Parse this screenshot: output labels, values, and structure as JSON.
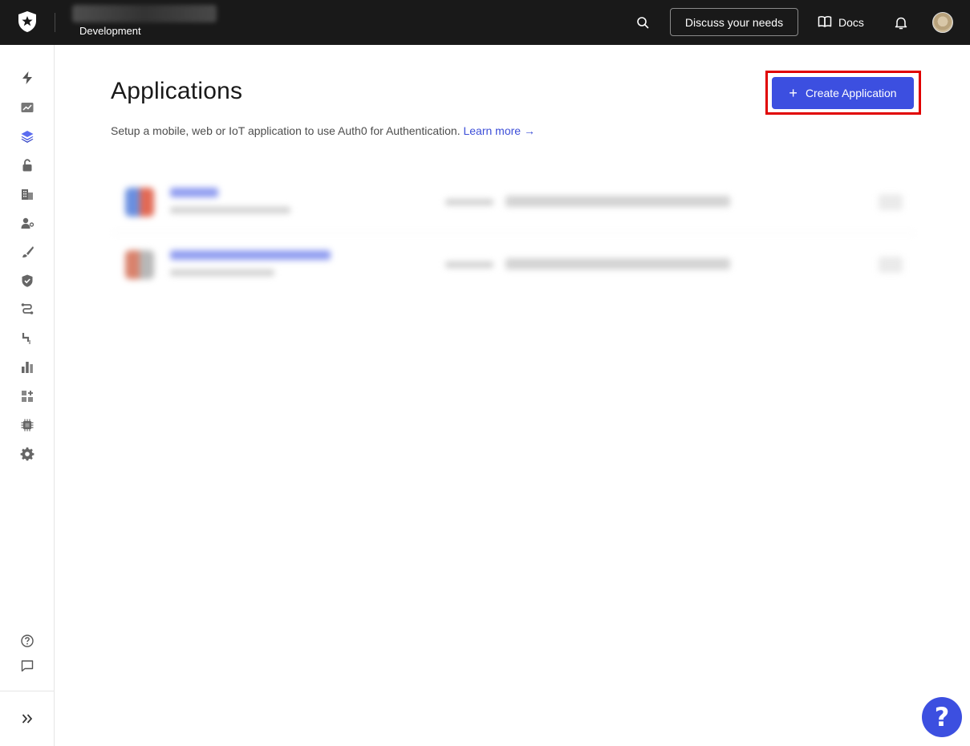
{
  "topbar": {
    "tenant_environment": "Development",
    "discuss_label": "Discuss your needs",
    "docs_label": "Docs"
  },
  "sidebar": {
    "items": [
      {
        "icon": "lightning-icon"
      },
      {
        "icon": "activity-chart-icon"
      },
      {
        "icon": "applications-stack-icon",
        "active": true
      },
      {
        "icon": "lock-icon"
      },
      {
        "icon": "organizations-building-icon"
      },
      {
        "icon": "user-management-icon"
      },
      {
        "icon": "branding-brush-icon"
      },
      {
        "icon": "security-shield-icon"
      },
      {
        "icon": "actions-flow-icon"
      },
      {
        "icon": "auth-pipeline-icon"
      },
      {
        "icon": "monitoring-bars-icon"
      },
      {
        "icon": "marketplace-icon"
      },
      {
        "icon": "extensions-chip-icon"
      },
      {
        "icon": "settings-gear-icon"
      }
    ],
    "bottom_items": [
      {
        "icon": "help-circle-icon"
      },
      {
        "icon": "feedback-chat-icon"
      },
      {
        "icon": "expand-chevrons-icon"
      }
    ]
  },
  "main": {
    "title": "Applications",
    "description": "Setup a mobile, web or IoT application to use Auth0 for Authentication.",
    "learn_more": "Learn more →",
    "create_button": "Create Application"
  },
  "help_fab": "?",
  "colors": {
    "topbar_bg": "#191919",
    "accent": "#3c4fe0",
    "highlight_outline": "#e00000",
    "link": "#3d4fd8"
  }
}
